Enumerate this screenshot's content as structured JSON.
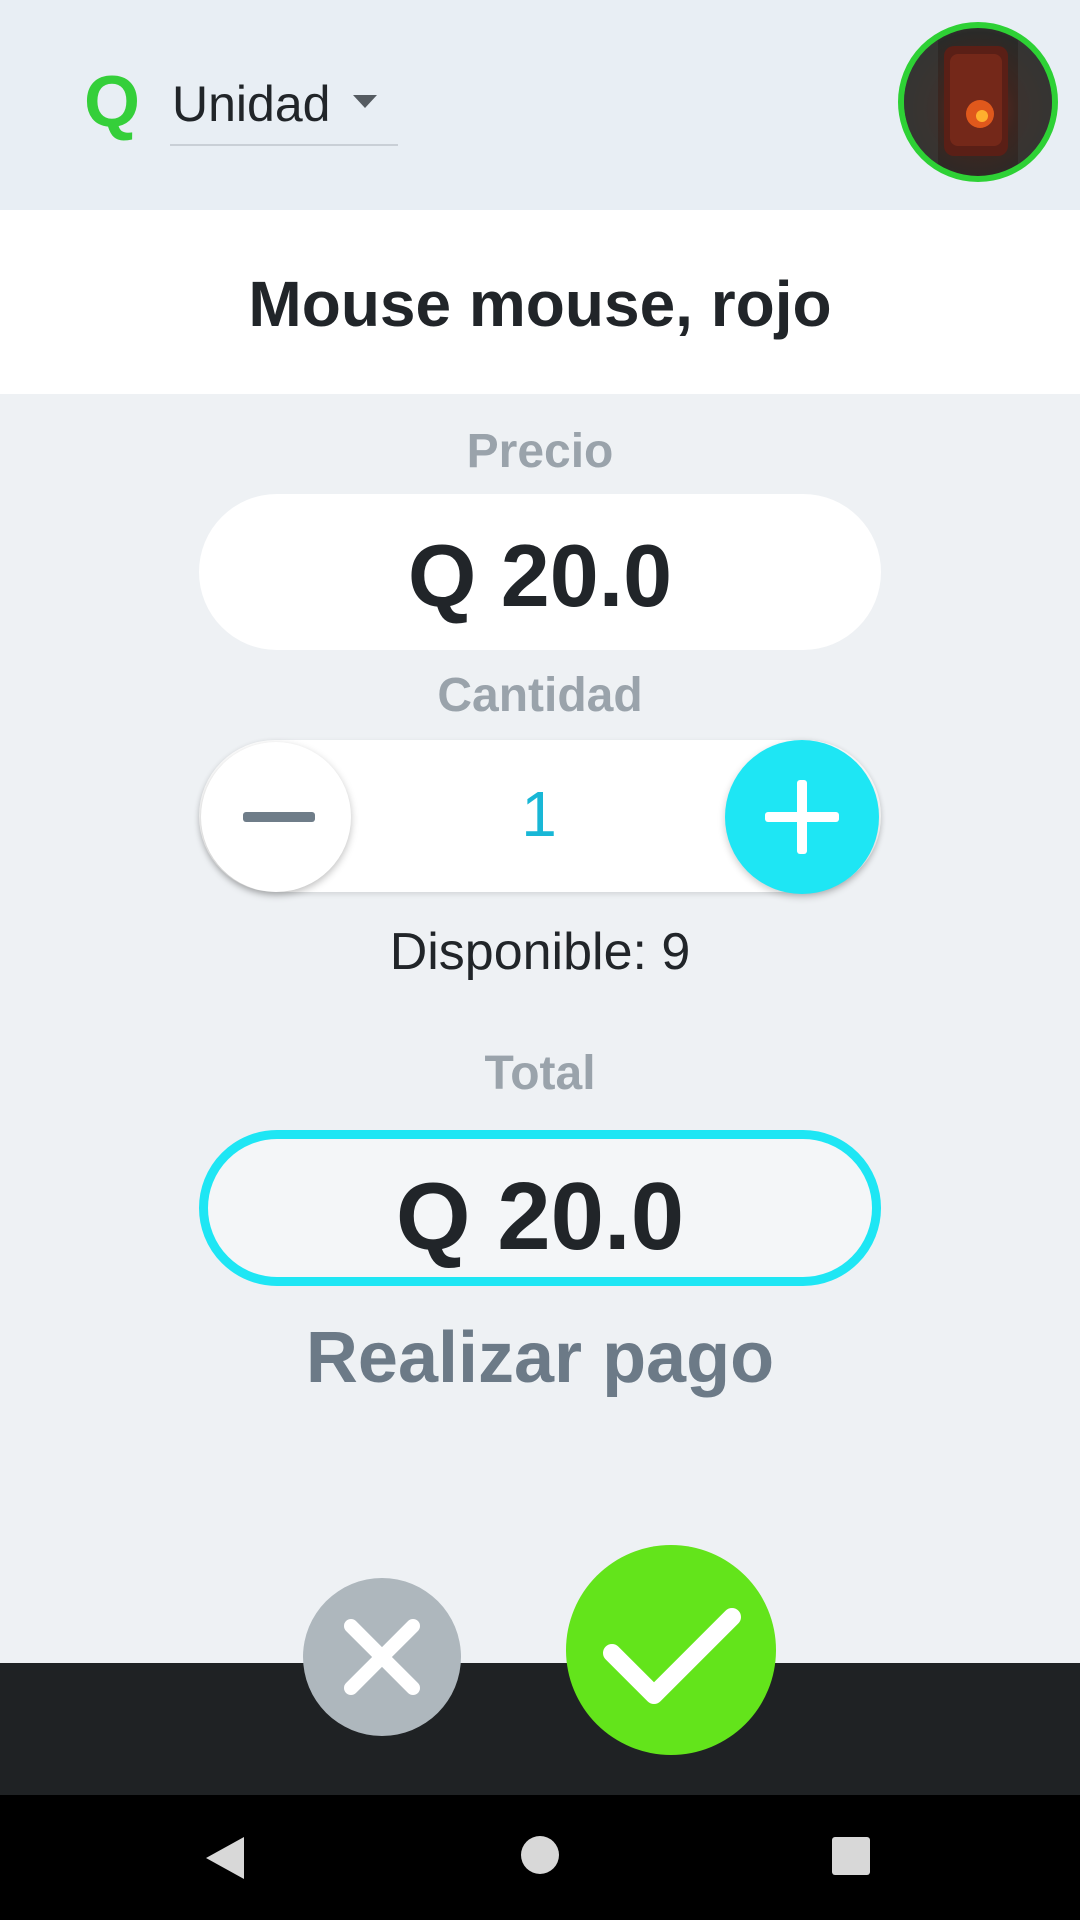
{
  "header": {
    "currency_symbol": "Q",
    "unit_select": {
      "selected": "Unidad"
    }
  },
  "product": {
    "title": "Mouse mouse, rojo"
  },
  "price": {
    "label": "Precio",
    "value": "Q 20.0"
  },
  "quantity": {
    "label": "Cantidad",
    "value": "1"
  },
  "availability": {
    "text": "Disponible: 9"
  },
  "total": {
    "label": "Total",
    "value": "Q 20.0"
  },
  "actions": {
    "pay_label": "Realizar pago"
  },
  "colors": {
    "brand_green": "#35cf3a",
    "accent_cyan": "#1ee6f4",
    "confirm_green": "#63e41b",
    "cancel_gray": "#aeb7bd"
  },
  "icons": {
    "caret": "chevron-down-icon",
    "minus": "minus-icon",
    "plus": "plus-icon",
    "cancel": "close-icon",
    "confirm": "check-icon",
    "nav_back": "back-triangle-icon",
    "nav_home": "home-circle-icon",
    "nav_recents": "recents-square-icon"
  }
}
